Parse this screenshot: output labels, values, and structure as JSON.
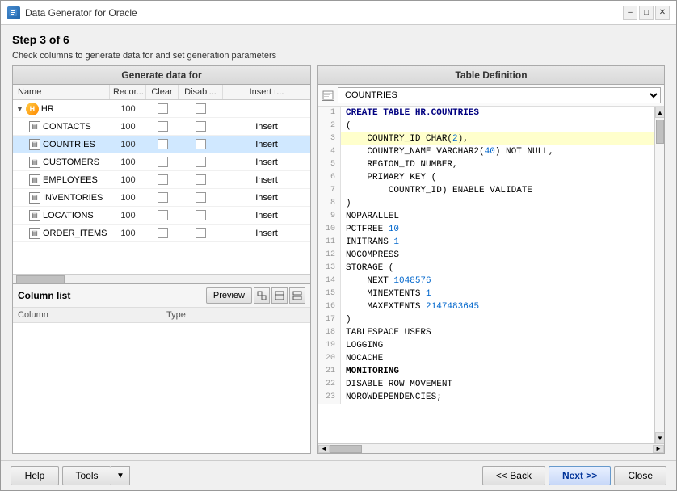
{
  "window": {
    "title": "Data Generator for Oracle",
    "icon": "DG"
  },
  "step": {
    "label": "Step 3 of 6",
    "description": "Check columns to generate data for and set generation parameters"
  },
  "left_panel": {
    "header": "Generate data for",
    "columns": {
      "name": "Name",
      "records": "Recor...",
      "clear": "Clear",
      "disable": "Disabl...",
      "insert": "Insert t..."
    },
    "rows": [
      {
        "type": "schema",
        "name": "HR",
        "records": "100",
        "indent": false,
        "has_records": true
      },
      {
        "type": "table",
        "name": "CONTACTS",
        "records": "100",
        "indent": true,
        "insert": "Insert"
      },
      {
        "type": "table",
        "name": "COUNTRIES",
        "records": "100",
        "indent": true,
        "insert": "Insert",
        "selected": true
      },
      {
        "type": "table",
        "name": "CUSTOMERS",
        "records": "100",
        "indent": true,
        "insert": "Insert"
      },
      {
        "type": "table",
        "name": "EMPLOYEES",
        "records": "100",
        "indent": true,
        "insert": "Insert"
      },
      {
        "type": "table",
        "name": "INVENTORIES",
        "records": "100",
        "indent": true,
        "insert": "Insert"
      },
      {
        "type": "table",
        "name": "LOCATIONS",
        "records": "100",
        "indent": true,
        "insert": "Insert"
      },
      {
        "type": "table",
        "name": "ORDER_ITEMS",
        "records": "100",
        "indent": true,
        "insert": "Insert"
      }
    ]
  },
  "column_list": {
    "title": "Column list",
    "preview_btn": "Preview",
    "columns": {
      "column": "Column",
      "type": "Type"
    }
  },
  "right_panel": {
    "header": "Table Definition",
    "selected_table": "COUNTRIES",
    "code_lines": [
      {
        "num": 1,
        "text": "CREATE TABLE HR.COUNTRIES",
        "bold": true
      },
      {
        "num": 2,
        "text": "("
      },
      {
        "num": 3,
        "text": "    COUNTRY_ID CHAR(2),",
        "highlight": true
      },
      {
        "num": 4,
        "text": "    COUNTRY_NAME VARCHAR2(40) NOT NULL,"
      },
      {
        "num": 5,
        "text": "    REGION_ID NUMBER,"
      },
      {
        "num": 6,
        "text": "    PRIMARY KEY ("
      },
      {
        "num": 7,
        "text": "        COUNTRY_ID) ENABLE VALIDATE"
      },
      {
        "num": 8,
        "text": ")"
      },
      {
        "num": 9,
        "text": "NOPARALLEL"
      },
      {
        "num": 10,
        "text": "PCTFREE 10"
      },
      {
        "num": 11,
        "text": "INITRANS 1"
      },
      {
        "num": 12,
        "text": "NOCOMPRESS"
      },
      {
        "num": 13,
        "text": "STORAGE ("
      },
      {
        "num": 14,
        "text": "    NEXT 1048576"
      },
      {
        "num": 15,
        "text": "    MINEXTENTS 1"
      },
      {
        "num": 16,
        "text": "    MAXEXTENTS 2147483645"
      },
      {
        "num": 17,
        "text": ")"
      },
      {
        "num": 18,
        "text": "TABLESPACE USERS"
      },
      {
        "num": 19,
        "text": "LOGGING"
      },
      {
        "num": 20,
        "text": "NOCACHE"
      },
      {
        "num": 21,
        "text": "MONITORING"
      },
      {
        "num": 22,
        "text": "DISABLE ROW MOVEMENT"
      },
      {
        "num": 23,
        "text": "NOROWDEPENDENCIES;"
      }
    ]
  },
  "bottom": {
    "help_label": "Help",
    "tools_label": "Tools",
    "back_label": "<< Back",
    "next_label": "Next >>",
    "close_label": "Close"
  }
}
